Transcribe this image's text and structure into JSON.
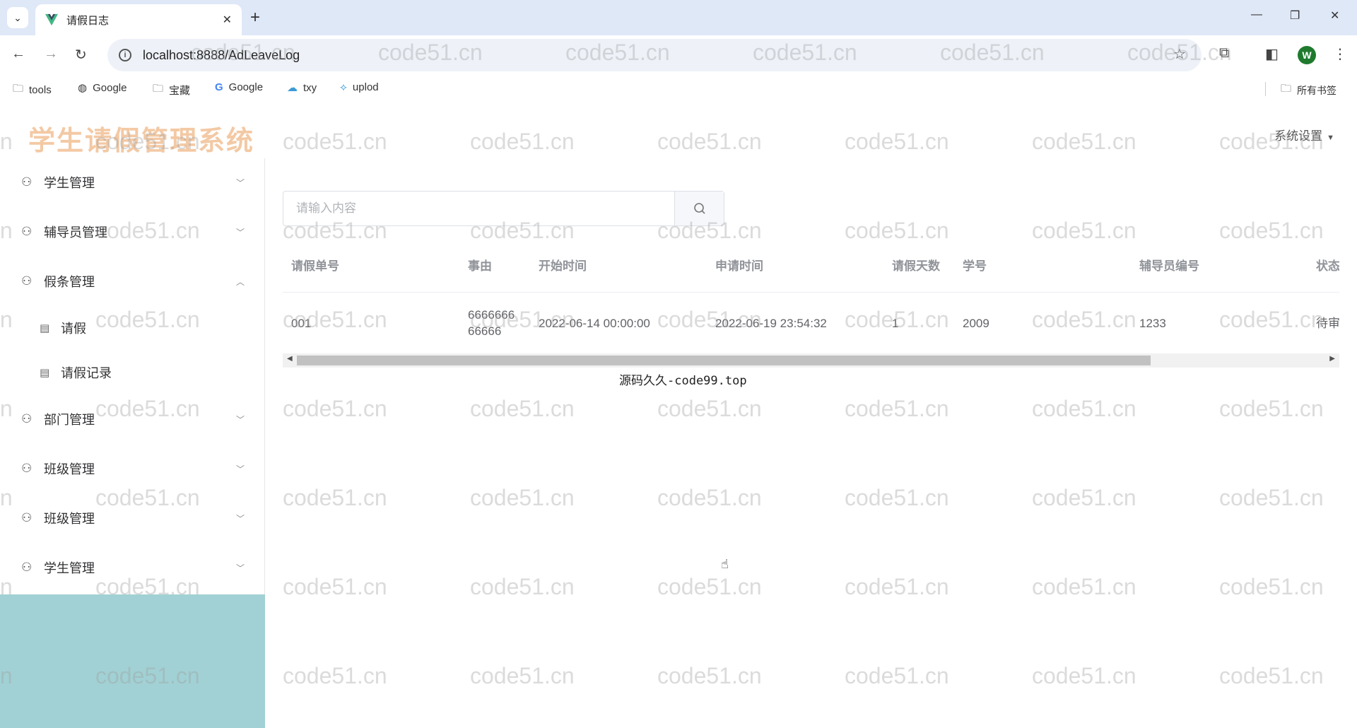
{
  "browser": {
    "tab_title": "请假日志",
    "url": "localhost:8888/AdLeaveLog",
    "bookmarks": [
      "tools",
      "Google",
      "宝藏",
      "Google",
      "txy",
      "uplod"
    ],
    "all_bookmarks": "所有书签",
    "profile_initial": "W"
  },
  "app": {
    "logo": "学生请假管理系统",
    "settings_label": "系统设置"
  },
  "sidebar": {
    "items": [
      {
        "label": "学生管理"
      },
      {
        "label": "辅导员管理"
      },
      {
        "label": "假条管理"
      },
      {
        "label": "请假"
      },
      {
        "label": "请假记录"
      },
      {
        "label": "部门管理"
      },
      {
        "label": "班级管理"
      },
      {
        "label": "班级管理"
      },
      {
        "label": "学生管理"
      }
    ]
  },
  "search": {
    "placeholder": "请输入内容"
  },
  "table": {
    "headers": [
      "请假单号",
      "事由",
      "开始时间",
      "申请时间",
      "请假天数",
      "学号",
      "辅导员编号",
      "状态"
    ],
    "rows": [
      {
        "id": "001",
        "reason_line1": "6666666",
        "reason_line2": "66666",
        "start": "2022-06-14 00:00:00",
        "applied": "2022-06-19 23:54:32",
        "days": "1",
        "student_no": "2009",
        "counselor_no": "1233",
        "status": "待审"
      }
    ]
  },
  "caption": "源码久久-code99.top",
  "watermark_text": "code51.cn"
}
